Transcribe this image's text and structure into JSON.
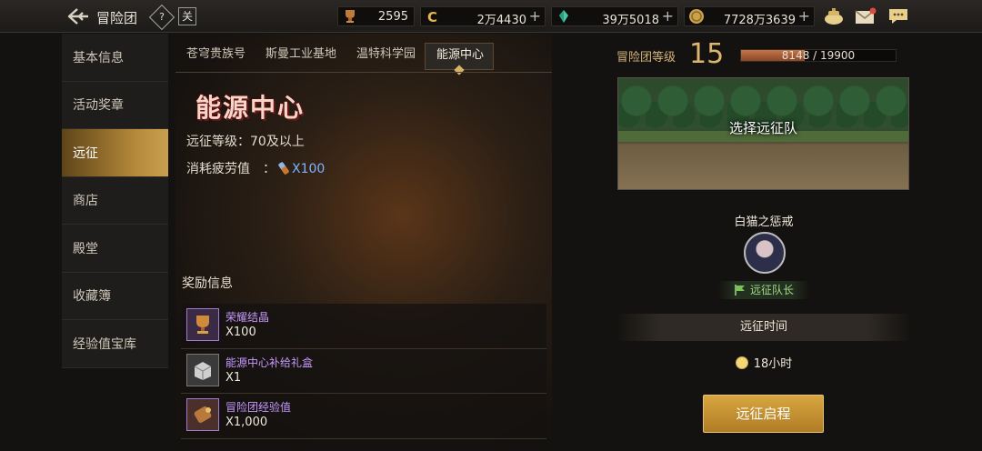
{
  "topbar": {
    "title": "冒险团",
    "help_label": "?",
    "game_label": "关",
    "currencies": [
      {
        "name": "trophy",
        "value": "2595"
      },
      {
        "name": "gold-c",
        "value": "2万4430"
      },
      {
        "name": "crystal",
        "value": "39万5018"
      },
      {
        "name": "coin",
        "value": "7728万3639"
      }
    ],
    "plus": "+"
  },
  "sidebar": {
    "items": [
      {
        "label": "基本信息"
      },
      {
        "label": "活动奖章"
      },
      {
        "label": "远征"
      },
      {
        "label": "商店"
      },
      {
        "label": "殿堂"
      },
      {
        "label": "收藏簿"
      },
      {
        "label": "经验值宝库"
      }
    ],
    "active_index": 2
  },
  "center": {
    "tabs": [
      {
        "label": "苍穹贵族号"
      },
      {
        "label": "斯曼工业基地"
      },
      {
        "label": "温特科学园"
      },
      {
        "label": "能源中心"
      }
    ],
    "dungeon_title": "能源中心",
    "level_req_label": "远征等级：",
    "level_req_value": "70及以上",
    "fatigue_label": "消耗疲劳值　：",
    "fatigue_value": "X100",
    "reward_title": "奖励信息",
    "rewards": [
      {
        "name": "荣耀结晶",
        "qty": "X100"
      },
      {
        "name": "能源中心补给礼盒",
        "qty": "X1"
      },
      {
        "name": "冒险团经验值",
        "qty": "X1,000"
      }
    ]
  },
  "right": {
    "level_label": "冒险团等级",
    "level_value": "15",
    "exp_text": "8148 / 19900",
    "exp_fraction": 0.409,
    "scene_label": "选择远征队",
    "boss_name": "白猫之惩戒",
    "leader_tag": "远征队长",
    "time_header": "远征时间",
    "time_value": "18小时",
    "start_button": "远征启程"
  }
}
